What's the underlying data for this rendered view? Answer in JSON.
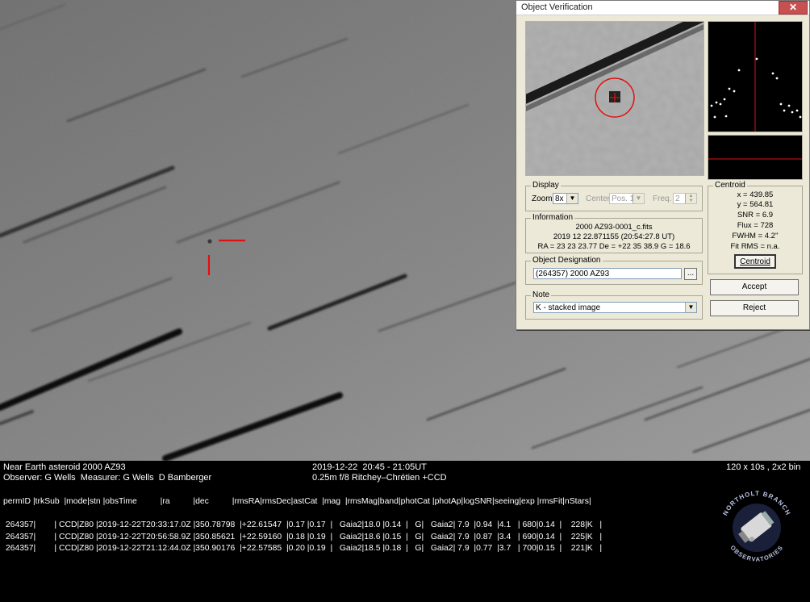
{
  "dialog": {
    "title": "Object Verification",
    "close_glyph": "✕",
    "display": {
      "label": "Display",
      "zoom_label": "Zoom",
      "zoom_value": "8x",
      "center_label": "Center",
      "center_value": "Pos. 1",
      "freq_label": "Freq.",
      "freq_value": "2"
    },
    "information": {
      "label": "Information",
      "file": "2000 AZ93-0001_c.fits",
      "date": "2019 12 22.871155 (20:54:27.8 UT)",
      "coords": "RA = 23 23 23.77   De = +22 35 38.9   G = 18.6"
    },
    "designation": {
      "label": "Object Designation",
      "value": "(264357) 2000 AZ93",
      "browse_label": "..."
    },
    "note": {
      "label": "Note",
      "value": "K - stacked image"
    },
    "centroid": {
      "label": "Centroid",
      "x": "x = 439.85",
      "y": "y = 564.81",
      "snr": "SNR = 6.9",
      "flux": "Flux = 728",
      "fwhm": "FWHM = 4.2''",
      "fitrms": "Fit RMS = n.a.",
      "button_label": "Centroid"
    },
    "accept_label": "Accept",
    "reject_label": "Reject",
    "colors": {
      "marker": "#e01010",
      "dialog_bg": "#ece9d8"
    }
  },
  "caption": {
    "object": "Near Earth asteroid 2000 AZ93",
    "observer": "Observer: G Wells  Measurer: G Wells  D Bamberger",
    "datetime": "2019-12-22  20:45 - 21:05UT",
    "telescope": "0.25m f/8 Ritchey–Chrétien +CCD",
    "exposure": "120 x 10s , 2x2 bin",
    "header": "permID |trkSub  |mode|stn |obsTime          |ra          |dec          |rmsRA|rmsDec|astCat  |mag  |rmsMag|band|photCat |photAp|logSNR|seeing|exp |rmsFit|nStars|",
    "rows": [
      " 264357|        | CCD|Z80 |2019-12-22T20:33:17.0Z |350.78798  |+22.61547  |0.17 |0.17  |   Gaia2|18.0 |0.14  |   G|   Gaia2| 7.9  |0.94  |4.1   | 680|0.14  |    228|K   |",
      " 264357|        | CCD|Z80 |2019-12-22T20:56:58.9Z |350.85621  |+22.59160  |0.18 |0.19  |   Gaia2|18.6 |0.15  |   G|   Gaia2| 7.9  |0.87  |3.4   | 690|0.14  |    225|K   |",
      " 264357|        | CCD|Z80 |2019-12-22T21:12:44.0Z |350.90176  |+22.57585  |0.20 |0.19  |   Gaia2|18.5 |0.18  |   G|   Gaia2| 7.9  |0.77  |3.7   | 700|0.15  |    221|K   |"
    ],
    "logo_top": "NORTHOLT BRANCH",
    "logo_bottom": "OBSERVATORIES"
  }
}
